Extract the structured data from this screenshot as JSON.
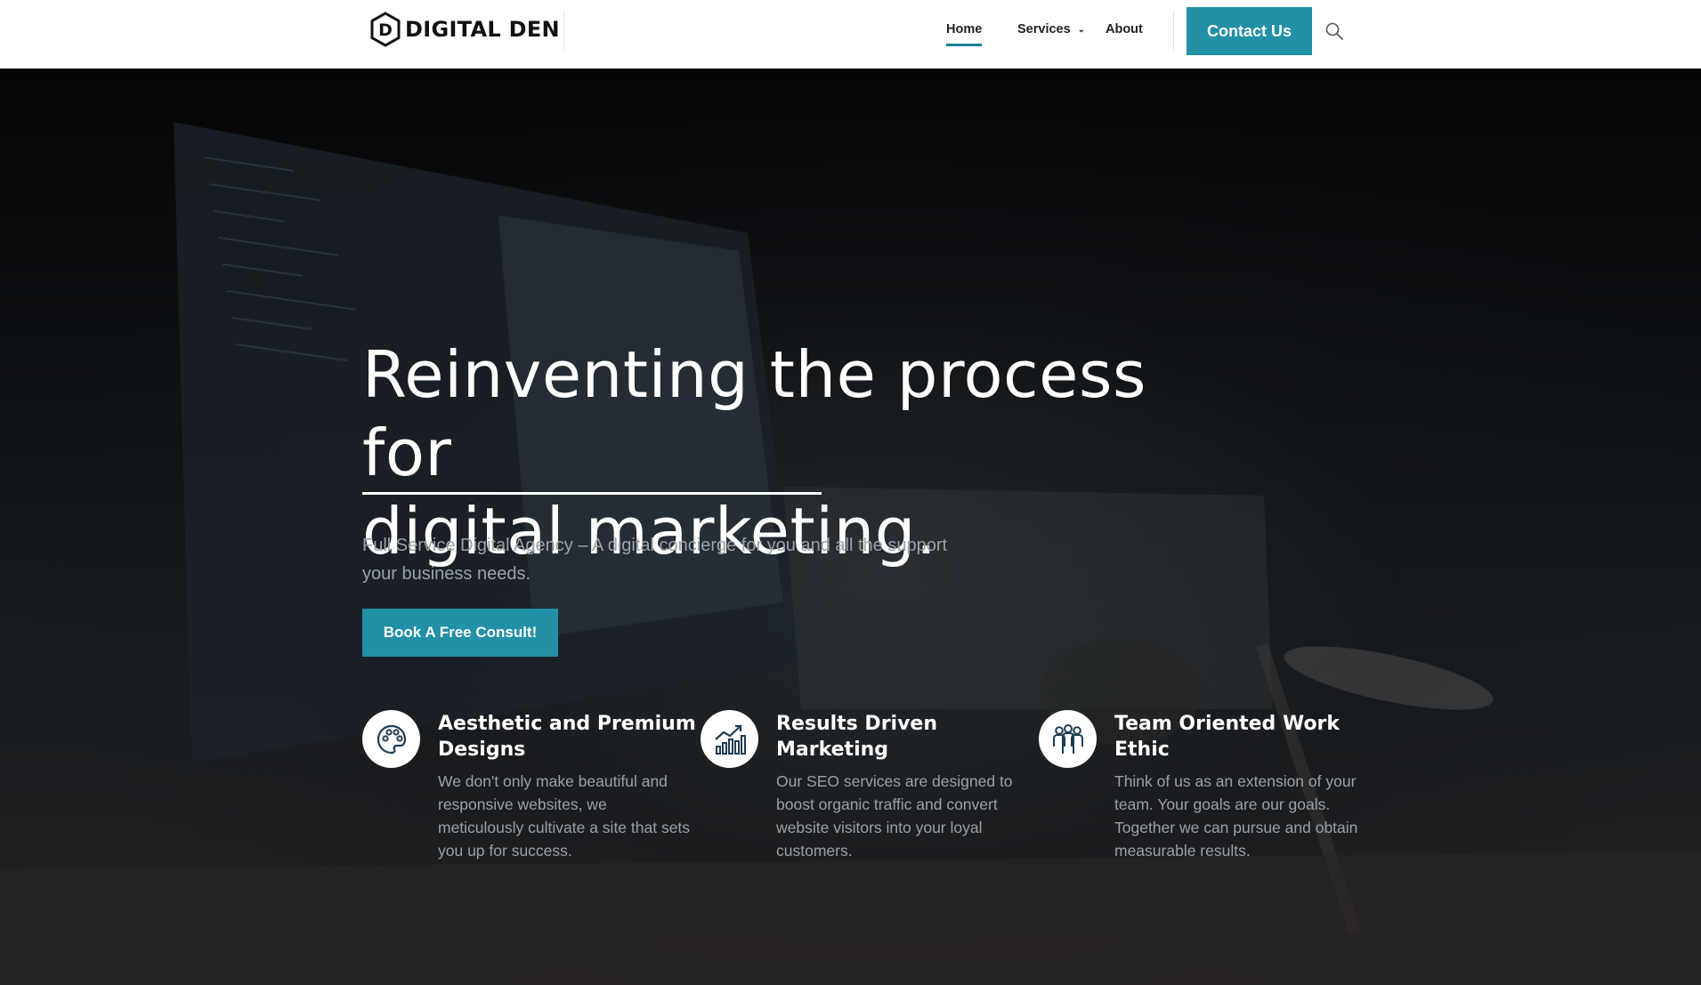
{
  "brand": {
    "logo_letter": "D",
    "name": "DIGITAL DEN"
  },
  "nav": {
    "items": [
      {
        "label": "Home",
        "active": true
      },
      {
        "label": "Services",
        "has_dropdown": true
      },
      {
        "label": "About"
      }
    ],
    "contact_label": "Contact Us",
    "search_icon": "search-icon"
  },
  "hero": {
    "title_line1": "Reinventing the process for",
    "title_line2": "digital marketing.",
    "subtitle": "Full Service Digital Agency – A digital concierge for you and all the support your business needs.",
    "cta_label": "Book A Free Consult!"
  },
  "features": [
    {
      "icon": "palette-icon",
      "title": "Aesthetic and Premium Designs",
      "text": "We don't only make beautiful and responsive websites, we meticulously cultivate a site that sets you up for success."
    },
    {
      "icon": "chart-growth-icon",
      "title": "Results Driven Marketing",
      "text": "Our SEO services are designed to boost organic traffic and convert website visitors into your loyal customers."
    },
    {
      "icon": "team-icon",
      "title": "Team Oriented Work Ethic",
      "text": "Think of us as an extension of your team. Your goals are our goals. Together we can pursue and obtain measurable results."
    }
  ],
  "colors": {
    "accent": "#2290a6",
    "nav_underline": "#1c7f91",
    "header_bg": "#ffffff",
    "hero_text": "#ffffff",
    "muted_text": "#9aa2a8"
  }
}
